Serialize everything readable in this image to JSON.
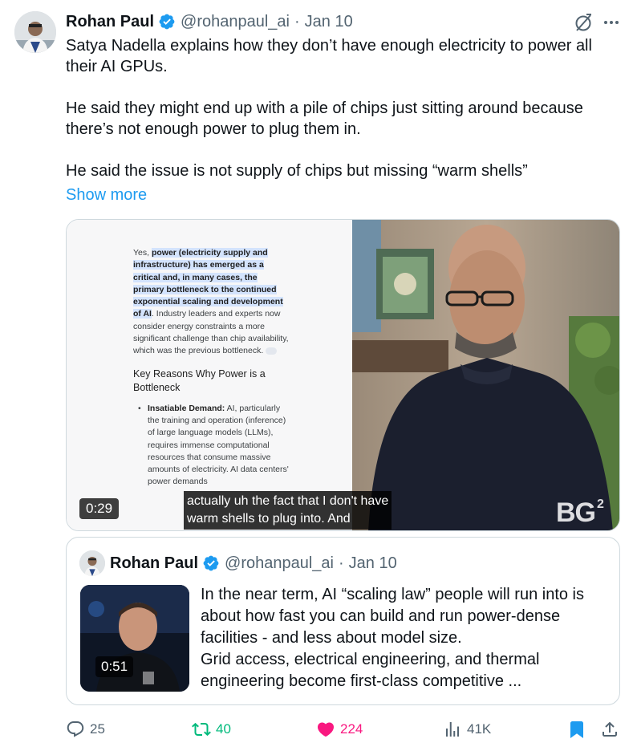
{
  "tweet": {
    "author_name": "Rohan Paul",
    "handle": "@rohanpaul_ai",
    "separator": "·",
    "date": "Jan 10",
    "paragraphs": [
      "Satya Nadella explains how they don’t have enough electricity to power all their AI GPUs.",
      "He said they might end up with a pile of chips just sitting around because there’s not enough power to plug them in.",
      "He said the issue is not supply of chips but missing “warm shells”"
    ],
    "show_more": "Show more"
  },
  "media": {
    "doc": {
      "intro_plain": "Yes, ",
      "intro_highlight": "power (electricity supply and infrastructure) has emerged as a critical and, in many cases, the primary bottleneck to the continued exponential scaling and development of AI",
      "intro_rest": ". Industry leaders and experts now consider energy constraints a more significant challenge than chip availability, which was the previous bottleneck.",
      "heading": "Key Reasons Why Power is a Bottleneck",
      "bullet_title": "Insatiable Demand:",
      "bullet_text": " AI, particularly the training and operation (inference) of large language models (LLMs), requires immense computational resources that consume massive amounts of electricity. AI data centers' power demands"
    },
    "duration": "0:29",
    "subtitle_line1": "actually uh the fact that I don't have",
    "subtitle_line2": "warm shells to plug into. And",
    "watermark": "BG",
    "watermark_sup": "2"
  },
  "quote": {
    "author_name": "Rohan Paul",
    "handle": "@rohanpaul_ai",
    "separator": "·",
    "date": "Jan 10",
    "duration": "0:51",
    "text_1": "In the near term, AI “scaling law” people will run into is about how fast you can build and run power-dense facilities - and less about model size.",
    "text_2": "Grid access, electrical engineering, and thermal engineering become first-class competitive ..."
  },
  "actions": {
    "replies": "25",
    "retweets": "40",
    "likes": "224",
    "views": "41K"
  },
  "colors": {
    "accent": "#1d9bf0",
    "text": "#0f1419",
    "muted": "#536471",
    "retweet": "#00ba7c",
    "like": "#f91880",
    "border": "#cfd9de"
  },
  "icons": [
    "verified-badge-icon",
    "grok-icon",
    "more-icon",
    "reply-icon",
    "retweet-icon",
    "like-icon",
    "views-icon",
    "bookmark-icon",
    "share-icon"
  ]
}
